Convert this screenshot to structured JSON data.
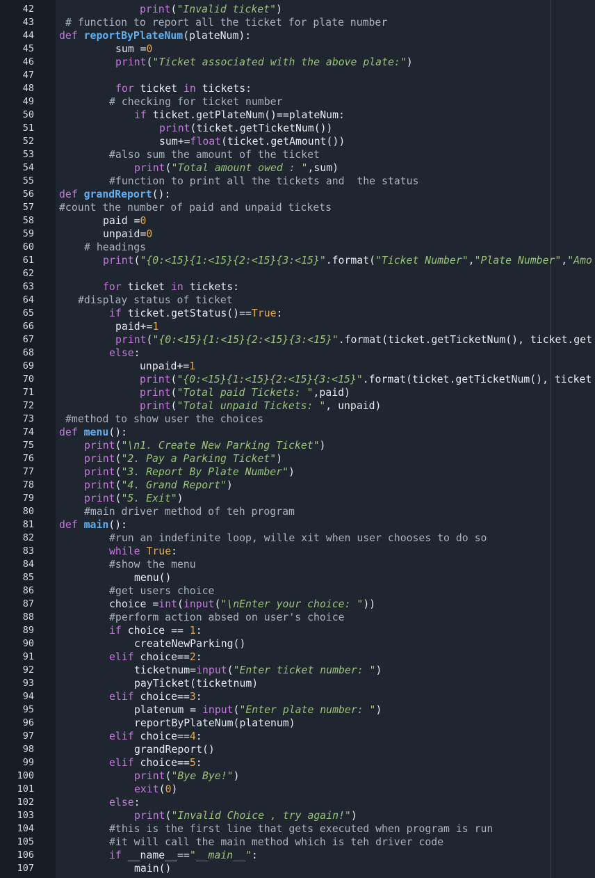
{
  "editor": {
    "language": "python",
    "lines": [
      {
        "n": "42",
        "indent": 201,
        "tokens": [
          [
            "fn-plain",
            "print"
          ],
          [
            "tx",
            "("
          ],
          [
            "st",
            "\"Invalid ticket\""
          ],
          [
            "tx",
            ")"
          ]
        ]
      },
      {
        "n": "43",
        "indent": 94,
        "tokens": [
          [
            "cm",
            "# function to report all the ticket for plate number"
          ]
        ]
      },
      {
        "n": "44",
        "indent": 85,
        "tokens": [
          [
            "kw",
            "def "
          ],
          [
            "fn",
            "reportByPlateNum"
          ],
          [
            "tx",
            "(plateNum):"
          ]
        ]
      },
      {
        "n": "45",
        "indent": 166,
        "tokens": [
          [
            "tx",
            "sum ="
          ],
          [
            "nm",
            "0"
          ]
        ]
      },
      {
        "n": "46",
        "indent": 166,
        "tokens": [
          [
            "fn-plain",
            "print"
          ],
          [
            "tx",
            "("
          ],
          [
            "st",
            "\"Ticket associated with the above plate:\""
          ],
          [
            "tx",
            ")"
          ]
        ]
      },
      {
        "n": "47",
        "indent": 0,
        "tokens": []
      },
      {
        "n": "48",
        "indent": 166,
        "tokens": [
          [
            "kw",
            "for"
          ],
          [
            "tx",
            " ticket "
          ],
          [
            "kw",
            "in"
          ],
          [
            "tx",
            " tickets:"
          ]
        ]
      },
      {
        "n": "49",
        "indent": 157,
        "tokens": [
          [
            "cm",
            "# checking for ticket number"
          ]
        ]
      },
      {
        "n": "50",
        "indent": 193,
        "tokens": [
          [
            "kw",
            "if"
          ],
          [
            "tx",
            " ticket.getPlateNum()==plateNum:"
          ]
        ]
      },
      {
        "n": "51",
        "indent": 229,
        "tokens": [
          [
            "fn-plain",
            "print"
          ],
          [
            "tx",
            "(ticket.getTicketNum())"
          ]
        ]
      },
      {
        "n": "52",
        "indent": 229,
        "tokens": [
          [
            "tx",
            "sum+="
          ],
          [
            "bi",
            "float"
          ],
          [
            "tx",
            "(ticket.getAmount())"
          ]
        ]
      },
      {
        "n": "53",
        "indent": 157,
        "tokens": [
          [
            "cm",
            "#also sum the amount of the ticket"
          ]
        ]
      },
      {
        "n": "54",
        "indent": 193,
        "tokens": [
          [
            "fn-plain",
            "print"
          ],
          [
            "tx",
            "("
          ],
          [
            "st",
            "\"Total amount owed : \""
          ],
          [
            "tx",
            ",sum)"
          ]
        ]
      },
      {
        "n": "55",
        "indent": 157,
        "tokens": [
          [
            "cm",
            "#function to print all the tickets and  the status"
          ]
        ]
      },
      {
        "n": "56",
        "indent": 85,
        "tokens": [
          [
            "kw",
            "def "
          ],
          [
            "fn",
            "grandReport"
          ],
          [
            "tx",
            "():"
          ]
        ]
      },
      {
        "n": "57",
        "indent": 85,
        "tokens": [
          [
            "cm",
            "#count the number of paid and unpaid tickets"
          ]
        ]
      },
      {
        "n": "58",
        "indent": 148,
        "tokens": [
          [
            "tx",
            "paid ="
          ],
          [
            "nm",
            "0"
          ]
        ]
      },
      {
        "n": "59",
        "indent": 148,
        "tokens": [
          [
            "tx",
            "unpaid="
          ],
          [
            "nm",
            "0"
          ]
        ]
      },
      {
        "n": "60",
        "indent": 121,
        "tokens": [
          [
            "cm",
            "# headings"
          ]
        ]
      },
      {
        "n": "61",
        "indent": 148,
        "tokens": [
          [
            "fn-plain",
            "print"
          ],
          [
            "tx",
            "("
          ],
          [
            "st",
            "\"{0:<15}{1:<15}{2:<15}{3:<15}\""
          ],
          [
            "tx",
            ".format("
          ],
          [
            "st",
            "\"Ticket Number\""
          ],
          [
            "tx",
            ","
          ],
          [
            "st",
            "\"Plate Number\""
          ],
          [
            "tx",
            ","
          ],
          [
            "st",
            "\"Amo"
          ]
        ]
      },
      {
        "n": "62",
        "indent": 0,
        "tokens": []
      },
      {
        "n": "63",
        "indent": 148,
        "tokens": [
          [
            "kw",
            "for"
          ],
          [
            "tx",
            " ticket "
          ],
          [
            "kw",
            "in"
          ],
          [
            "tx",
            " tickets:"
          ]
        ]
      },
      {
        "n": "64",
        "indent": 112,
        "tokens": [
          [
            "cm",
            "#display status of ticket"
          ]
        ]
      },
      {
        "n": "65",
        "indent": 157,
        "tokens": [
          [
            "kw",
            "if"
          ],
          [
            "tx",
            " ticket.getStatus()=="
          ],
          [
            "nm",
            "True"
          ],
          [
            "tx",
            ":"
          ]
        ]
      },
      {
        "n": "66",
        "indent": 166,
        "tokens": [
          [
            "tx",
            "paid+="
          ],
          [
            "nm",
            "1"
          ]
        ]
      },
      {
        "n": "67",
        "indent": 166,
        "tokens": [
          [
            "fn-plain",
            "print"
          ],
          [
            "tx",
            "("
          ],
          [
            "st",
            "\"{0:<15}{1:<15}{2:<15}{3:<15}\""
          ],
          [
            "tx",
            ".format(ticket.getTicketNum(), ticket.get"
          ]
        ]
      },
      {
        "n": "68",
        "indent": 157,
        "tokens": [
          [
            "kw",
            "else"
          ],
          [
            "tx",
            ":"
          ]
        ]
      },
      {
        "n": "69",
        "indent": 201,
        "tokens": [
          [
            "tx",
            "unpaid+="
          ],
          [
            "nm",
            "1"
          ]
        ]
      },
      {
        "n": "70",
        "indent": 201,
        "tokens": [
          [
            "fn-plain",
            "print"
          ],
          [
            "tx",
            "("
          ],
          [
            "st",
            "\"{0:<15}{1:<15}{2:<15}{3:<15}\""
          ],
          [
            "tx",
            ".format(ticket.getTicketNum(), ticket"
          ]
        ]
      },
      {
        "n": "71",
        "indent": 201,
        "tokens": [
          [
            "fn-plain",
            "print"
          ],
          [
            "tx",
            "("
          ],
          [
            "st",
            "\"Total paid Tickets: \""
          ],
          [
            "tx",
            ",paid)"
          ]
        ]
      },
      {
        "n": "72",
        "indent": 201,
        "tokens": [
          [
            "fn-plain",
            "print"
          ],
          [
            "tx",
            "("
          ],
          [
            "st",
            "\"Total unpaid Tickets: \""
          ],
          [
            "tx",
            ", unpaid)"
          ]
        ]
      },
      {
        "n": "73",
        "indent": 94,
        "tokens": [
          [
            "cm",
            "#method to show user the choices"
          ]
        ]
      },
      {
        "n": "74",
        "indent": 85,
        "tokens": [
          [
            "kw",
            "def "
          ],
          [
            "fn",
            "menu"
          ],
          [
            "tx",
            "():"
          ]
        ]
      },
      {
        "n": "75",
        "indent": 121,
        "tokens": [
          [
            "fn-plain",
            "print"
          ],
          [
            "tx",
            "("
          ],
          [
            "st",
            "\"\\n1. Create New Parking Ticket\""
          ],
          [
            "tx",
            ")"
          ]
        ]
      },
      {
        "n": "76",
        "indent": 121,
        "tokens": [
          [
            "fn-plain",
            "print"
          ],
          [
            "tx",
            "("
          ],
          [
            "st",
            "\"2. Pay a Parking Ticket\""
          ],
          [
            "tx",
            ")"
          ]
        ]
      },
      {
        "n": "77",
        "indent": 121,
        "tokens": [
          [
            "fn-plain",
            "print"
          ],
          [
            "tx",
            "("
          ],
          [
            "st",
            "\"3. Report By Plate Number\""
          ],
          [
            "tx",
            ")"
          ]
        ]
      },
      {
        "n": "78",
        "indent": 121,
        "tokens": [
          [
            "fn-plain",
            "print"
          ],
          [
            "tx",
            "("
          ],
          [
            "st",
            "\"4. Grand Report\""
          ],
          [
            "tx",
            ")"
          ]
        ]
      },
      {
        "n": "79",
        "indent": 121,
        "tokens": [
          [
            "fn-plain",
            "print"
          ],
          [
            "tx",
            "("
          ],
          [
            "st",
            "\"5. Exit\""
          ],
          [
            "tx",
            ")"
          ]
        ]
      },
      {
        "n": "80",
        "indent": 121,
        "tokens": [
          [
            "cm",
            "#main driver method of teh program"
          ]
        ]
      },
      {
        "n": "81",
        "indent": 85,
        "tokens": [
          [
            "kw",
            "def "
          ],
          [
            "fn",
            "main"
          ],
          [
            "tx",
            "():"
          ]
        ]
      },
      {
        "n": "82",
        "indent": 157,
        "tokens": [
          [
            "cm",
            "#run an indefinite loop, wille xit when user chooses to do so"
          ]
        ]
      },
      {
        "n": "83",
        "indent": 157,
        "tokens": [
          [
            "kw",
            "while"
          ],
          [
            "tx",
            " "
          ],
          [
            "nm",
            "True"
          ],
          [
            "tx",
            ":"
          ]
        ]
      },
      {
        "n": "84",
        "indent": 157,
        "tokens": [
          [
            "cm",
            "#show the menu"
          ]
        ]
      },
      {
        "n": "85",
        "indent": 193,
        "tokens": [
          [
            "tx",
            "menu()"
          ]
        ]
      },
      {
        "n": "86",
        "indent": 157,
        "tokens": [
          [
            "cm",
            "#get users choice"
          ]
        ]
      },
      {
        "n": "87",
        "indent": 157,
        "tokens": [
          [
            "tx",
            "choice ="
          ],
          [
            "bi",
            "int"
          ],
          [
            "tx",
            "("
          ],
          [
            "bi",
            "input"
          ],
          [
            "tx",
            "("
          ],
          [
            "st",
            "\"\\nEnter your choice: \""
          ],
          [
            "tx",
            "))"
          ]
        ]
      },
      {
        "n": "88",
        "indent": 157,
        "tokens": [
          [
            "cm",
            "#perform action absed on user's choice"
          ]
        ]
      },
      {
        "n": "89",
        "indent": 157,
        "tokens": [
          [
            "kw",
            "if"
          ],
          [
            "tx",
            " choice == "
          ],
          [
            "nm",
            "1"
          ],
          [
            "tx",
            ":"
          ]
        ]
      },
      {
        "n": "90",
        "indent": 193,
        "tokens": [
          [
            "tx",
            "createNewParking()"
          ]
        ]
      },
      {
        "n": "91",
        "indent": 157,
        "tokens": [
          [
            "kw",
            "elif"
          ],
          [
            "tx",
            " choice=="
          ],
          [
            "nm",
            "2"
          ],
          [
            "tx",
            ":"
          ]
        ]
      },
      {
        "n": "92",
        "indent": 193,
        "tokens": [
          [
            "tx",
            "ticketnum="
          ],
          [
            "bi",
            "input"
          ],
          [
            "tx",
            "("
          ],
          [
            "st",
            "\"Enter ticket number: \""
          ],
          [
            "tx",
            ")"
          ]
        ]
      },
      {
        "n": "93",
        "indent": 193,
        "tokens": [
          [
            "tx",
            "payTicket(ticketnum)"
          ]
        ]
      },
      {
        "n": "94",
        "indent": 157,
        "tokens": [
          [
            "kw",
            "elif"
          ],
          [
            "tx",
            " choice=="
          ],
          [
            "nm",
            "3"
          ],
          [
            "tx",
            ":"
          ]
        ]
      },
      {
        "n": "95",
        "indent": 193,
        "tokens": [
          [
            "tx",
            "platenum = "
          ],
          [
            "bi",
            "input"
          ],
          [
            "tx",
            "("
          ],
          [
            "st",
            "\"Enter plate number: \""
          ],
          [
            "tx",
            ")"
          ]
        ]
      },
      {
        "n": "96",
        "indent": 193,
        "tokens": [
          [
            "tx",
            "reportByPlateNum(platenum)"
          ]
        ]
      },
      {
        "n": "97",
        "indent": 157,
        "tokens": [
          [
            "kw",
            "elif"
          ],
          [
            "tx",
            " choice=="
          ],
          [
            "nm",
            "4"
          ],
          [
            "tx",
            ":"
          ]
        ]
      },
      {
        "n": "98",
        "indent": 193,
        "tokens": [
          [
            "tx",
            "grandReport()"
          ]
        ]
      },
      {
        "n": "99",
        "indent": 157,
        "tokens": [
          [
            "kw",
            "elif"
          ],
          [
            "tx",
            " choice=="
          ],
          [
            "nm",
            "5"
          ],
          [
            "tx",
            ":"
          ]
        ]
      },
      {
        "n": "100",
        "indent": 193,
        "tokens": [
          [
            "fn-plain",
            "print"
          ],
          [
            "tx",
            "("
          ],
          [
            "st",
            "\"Bye Bye!\""
          ],
          [
            "tx",
            ")"
          ]
        ]
      },
      {
        "n": "101",
        "indent": 193,
        "tokens": [
          [
            "fn-plain",
            "exit"
          ],
          [
            "tx",
            "("
          ],
          [
            "nm",
            "0"
          ],
          [
            "tx",
            ")"
          ]
        ]
      },
      {
        "n": "102",
        "indent": 157,
        "tokens": [
          [
            "kw",
            "else"
          ],
          [
            "tx",
            ":"
          ]
        ]
      },
      {
        "n": "103",
        "indent": 193,
        "tokens": [
          [
            "fn-plain",
            "print"
          ],
          [
            "tx",
            "("
          ],
          [
            "st",
            "\"Invalid Choice , try again!\""
          ],
          [
            "tx",
            ")"
          ]
        ]
      },
      {
        "n": "104",
        "indent": 157,
        "tokens": [
          [
            "cm",
            "#this is the first line that gets executed when program is run"
          ]
        ]
      },
      {
        "n": "105",
        "indent": 157,
        "tokens": [
          [
            "cm",
            "#it will call the main method which is teh driver code"
          ]
        ]
      },
      {
        "n": "106",
        "indent": 157,
        "tokens": [
          [
            "kw",
            "if"
          ],
          [
            "tx",
            " __name__=="
          ],
          [
            "st",
            "\"__main__\""
          ],
          [
            "tx",
            ":"
          ]
        ]
      },
      {
        "n": "107",
        "indent": 193,
        "tokens": [
          [
            "tx",
            "main()"
          ]
        ]
      }
    ]
  },
  "colors": {
    "background": "#1f2630",
    "gutter": "#181d24",
    "keyword": "#c678dd",
    "function_name": "#61afef",
    "string": "#98c379",
    "number": "#e5a84b",
    "comment": "#a9b2bd",
    "text": "#e6e9ed"
  }
}
